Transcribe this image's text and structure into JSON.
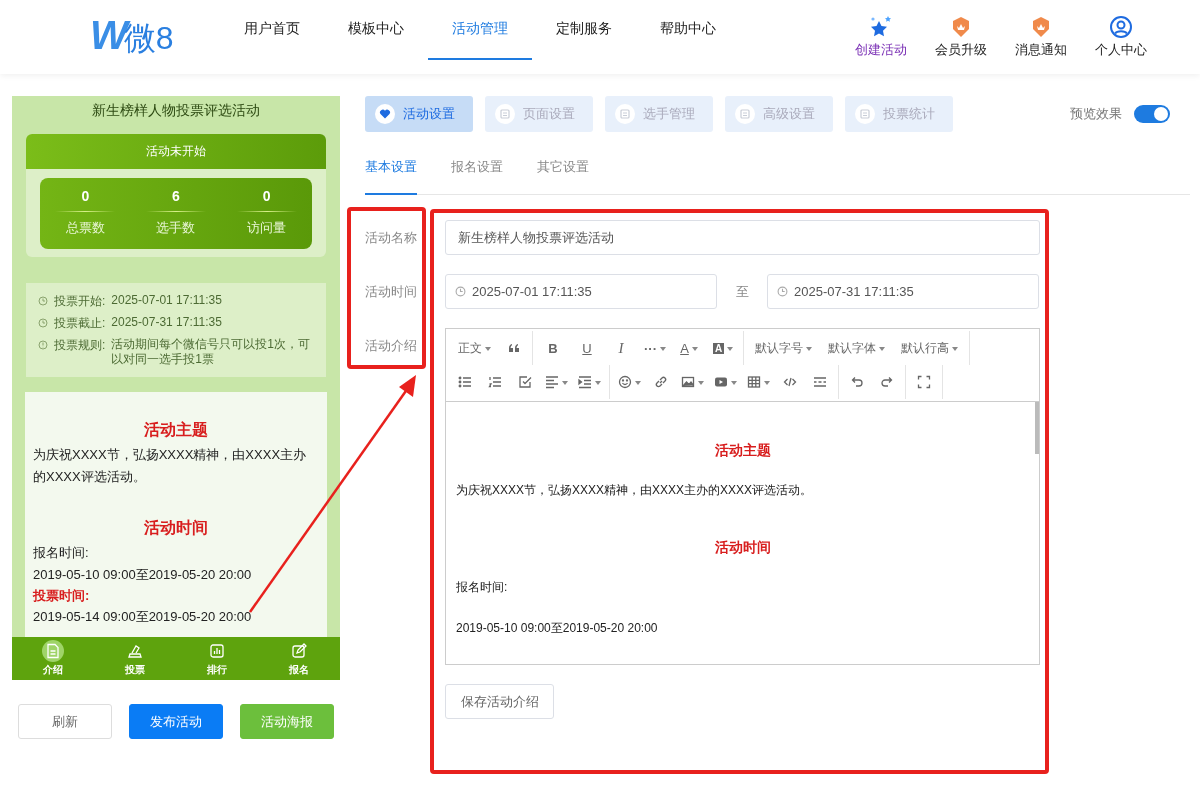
{
  "header": {
    "logo": {
      "mark": "W",
      "name": "微8"
    },
    "nav": [
      {
        "label": "用户首页",
        "selected": false
      },
      {
        "label": "模板中心",
        "selected": false
      },
      {
        "label": "活动管理",
        "selected": true
      },
      {
        "label": "定制服务",
        "selected": false
      },
      {
        "label": "帮助中心",
        "selected": false
      }
    ],
    "actions": [
      {
        "label": "创建活动",
        "kind": "star"
      },
      {
        "label": "会员升级",
        "kind": "badge"
      },
      {
        "label": "消息通知",
        "kind": "badge"
      },
      {
        "label": "个人中心",
        "kind": "user"
      }
    ]
  },
  "preview": {
    "title": "新生榜样人物投票评选活动",
    "status": "活动未开始",
    "stats": [
      {
        "value": "0",
        "label": "总票数"
      },
      {
        "value": "6",
        "label": "选手数"
      },
      {
        "value": "0",
        "label": "访问量"
      }
    ],
    "info": [
      {
        "kind": "clock",
        "label": "投票开始:",
        "value": "2025-07-01 17:11:35"
      },
      {
        "kind": "clock",
        "label": "投票截止:",
        "value": "2025-07-31 17:11:35"
      },
      {
        "kind": "alert",
        "label": "投票规则:",
        "value": "活动期间每个微信号只可以投1次，可以对同一选手投1票"
      }
    ],
    "content": [
      {
        "kind": "heading",
        "text": "活动主题"
      },
      {
        "kind": "text",
        "text": "为庆祝XXXX节，弘扬XXXX精神，由XXXX主办的XXXX评选活动。"
      },
      {
        "kind": "heading",
        "text": "活动时间"
      },
      {
        "kind": "text",
        "text": "报名时间:"
      },
      {
        "kind": "text",
        "text": "2019-05-10 09:00至2019-05-20 20:00"
      },
      {
        "kind": "label",
        "text": "投票时间:"
      },
      {
        "kind": "text",
        "text": "2019-05-14 09:00至2019-05-20 20:00"
      }
    ],
    "tabs": [
      {
        "label": "介绍",
        "selected": true
      },
      {
        "label": "投票",
        "selected": false
      },
      {
        "label": "排行",
        "selected": false
      },
      {
        "label": "报名",
        "selected": false
      }
    ],
    "buttons": [
      {
        "label": "刷新",
        "kind": "plain"
      },
      {
        "label": "发布活动",
        "kind": "primary"
      },
      {
        "label": "活动海报",
        "kind": "success"
      }
    ]
  },
  "tabs": [
    {
      "label": "活动设置",
      "selected": true
    },
    {
      "label": "页面设置",
      "selected": false
    },
    {
      "label": "选手管理",
      "selected": false
    },
    {
      "label": "高级设置",
      "selected": false
    },
    {
      "label": "投票统计",
      "selected": false
    }
  ],
  "preview_toggle": {
    "label": "预览效果",
    "on": true
  },
  "subtabs": [
    {
      "label": "基本设置",
      "selected": true
    },
    {
      "label": "报名设置",
      "selected": false
    },
    {
      "label": "其它设置",
      "selected": false
    }
  ],
  "form": {
    "name_label": "活动名称",
    "name_value": "新生榜样人物投票评选活动",
    "time_label": "活动时间",
    "start": "2025-07-01 17:11:35",
    "separator": "至",
    "end": "2025-07-31 17:11:35",
    "intro_label": "活动介绍",
    "toolbar": [
      [
        {
          "kind": "text",
          "label": "正文",
          "dropdown": true
        },
        {
          "kind": "icon",
          "dropdown": false
        }
      ],
      [
        {
          "kind": "glyph",
          "label": "B",
          "dropdown": false
        },
        {
          "kind": "glyph",
          "label": "U",
          "dropdown": false
        },
        {
          "kind": "glyph",
          "label": "I",
          "dropdown": false
        },
        {
          "kind": "glyph",
          "label": "···",
          "dropdown": true
        },
        {
          "kind": "glyph",
          "label": "A",
          "dropdown": true
        },
        {
          "kind": "glyph",
          "label": "A",
          "dropdown": true
        }
      ],
      [
        {
          "kind": "text",
          "label": "默认字号",
          "dropdown": true
        },
        {
          "kind": "text",
          "label": "默认字体",
          "dropdown": true
        },
        {
          "kind": "text",
          "label": "默认行高",
          "dropdown": true
        }
      ],
      [
        {
          "kind": "icon",
          "dropdown": false
        },
        {
          "kind": "icon",
          "dropdown": false
        },
        {
          "kind": "icon",
          "dropdown": false
        },
        {
          "kind": "icon",
          "dropdown": true
        },
        {
          "kind": "icon",
          "dropdown": true
        }
      ],
      [
        {
          "kind": "icon",
          "dropdown": true
        },
        {
          "kind": "icon",
          "dropdown": false
        },
        {
          "kind": "icon",
          "dropdown": true
        },
        {
          "kind": "icon",
          "dropdown": true
        },
        {
          "kind": "icon",
          "dropdown": true
        },
        {
          "kind": "icon",
          "dropdown": false
        },
        {
          "kind": "icon",
          "dropdown": false
        }
      ],
      [
        {
          "kind": "icon",
          "dropdown": false
        },
        {
          "kind": "icon",
          "dropdown": false
        }
      ],
      [
        {
          "kind": "icon",
          "dropdown": false
        }
      ]
    ],
    "content": [
      {
        "kind": "heading",
        "text": "活动主题"
      },
      {
        "kind": "text",
        "text": "为庆祝XXXX节，弘扬XXXX精神，由XXXX主办的XXXX评选活动。"
      },
      {
        "kind": "heading",
        "text": "活动时间"
      },
      {
        "kind": "text",
        "text": "报名时间:"
      },
      {
        "kind": "text",
        "text": "2019-05-10 09:00至2019-05-20 20:00"
      }
    ],
    "save": "保存活动介绍"
  }
}
